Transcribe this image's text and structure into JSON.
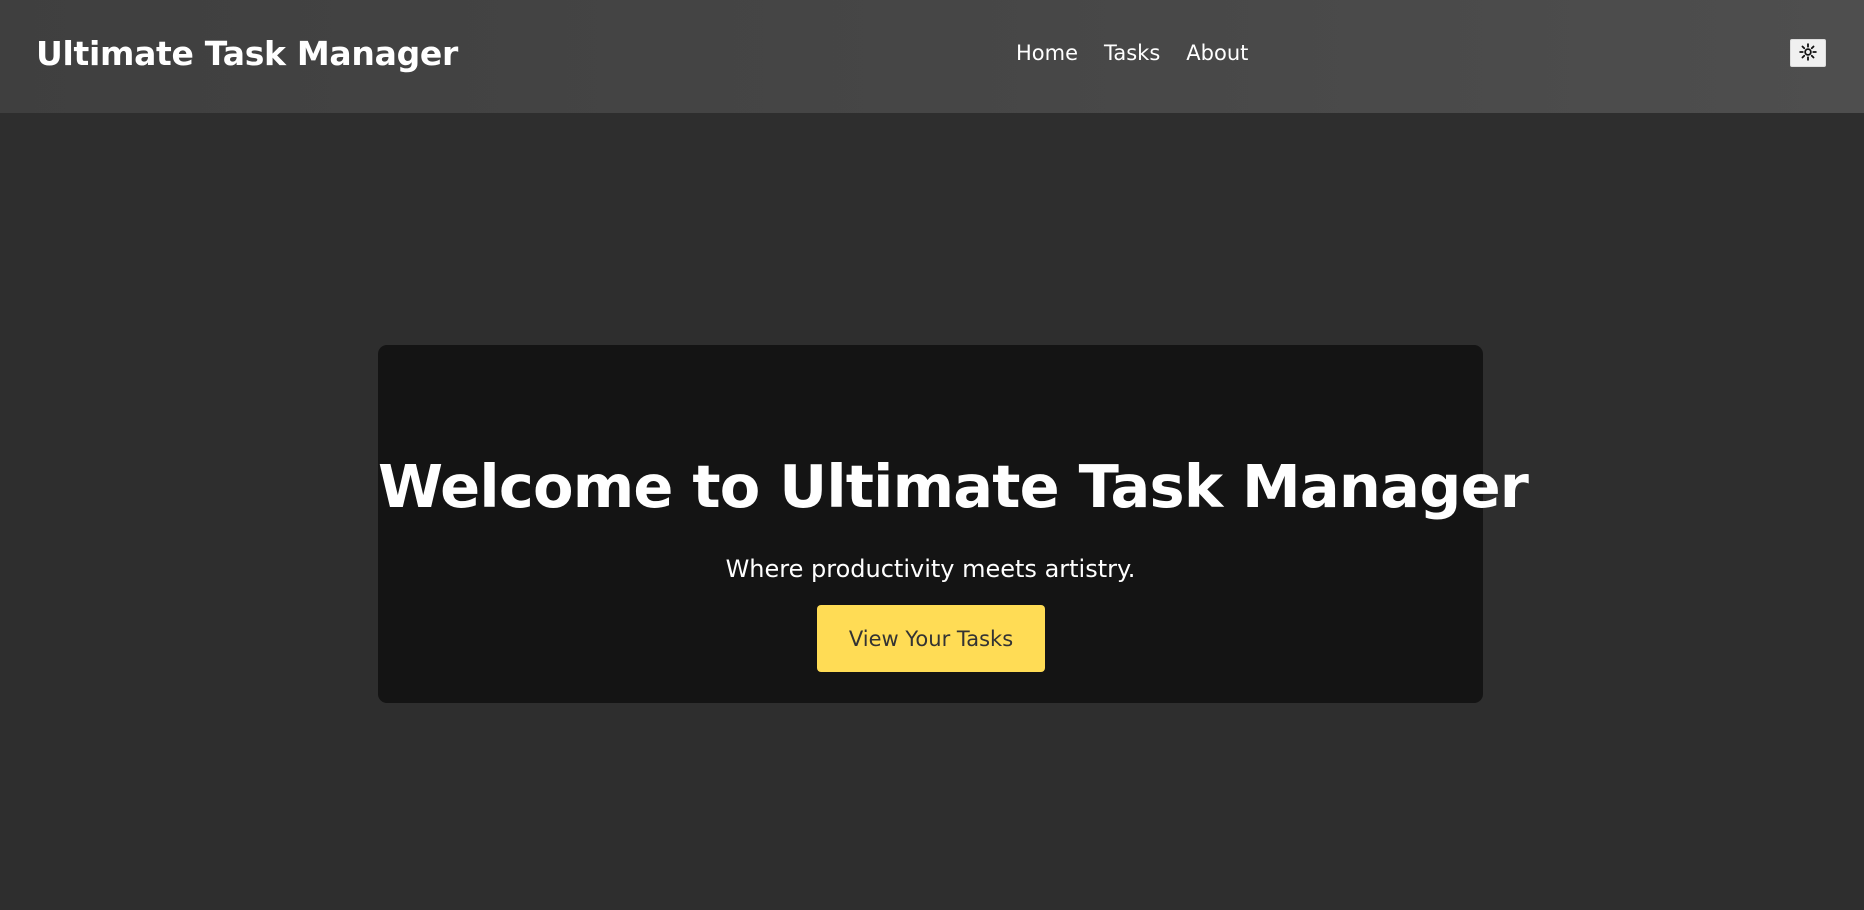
{
  "header": {
    "brand": "Ultimate Task Manager",
    "nav": [
      {
        "label": "Home"
      },
      {
        "label": "Tasks"
      },
      {
        "label": "About"
      }
    ],
    "theme_toggle_icon": "sun-icon"
  },
  "hero": {
    "title": "Welcome to Ultimate Task Manager",
    "subtitle": "Where productivity meets artistry.",
    "cta_label": "View Your Tasks"
  },
  "colors": {
    "page_background": "#2e2e2e",
    "header_background": "#464646",
    "hero_background": "#141414",
    "accent": "#ffdc55",
    "text": "#ffffff",
    "cta_text": "#333333"
  }
}
